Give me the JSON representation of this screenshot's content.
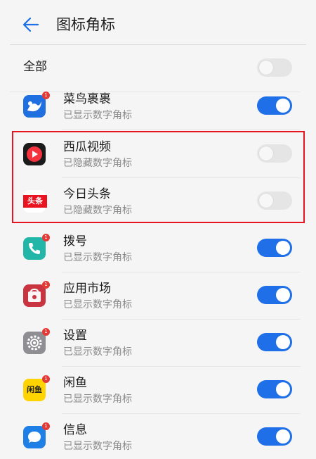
{
  "header": {
    "title": "图标角标"
  },
  "all_row": {
    "label": "全部",
    "toggle_on": false
  },
  "apps": [
    {
      "name": "菜鸟裹裹",
      "status": "已显示数字角标",
      "badge": "1",
      "toggle_on": true,
      "icon": "cainiao-icon"
    },
    {
      "name": "西瓜视频",
      "status": "已隐藏数字角标",
      "badge": "",
      "toggle_on": false,
      "icon": "xigua-icon"
    },
    {
      "name": "今日头条",
      "status": "已隐藏数字角标",
      "badge": "",
      "toggle_on": false,
      "icon": "toutiao-icon",
      "icon_text": "头条"
    },
    {
      "name": "拨号",
      "status": "已显示数字角标",
      "badge": "1",
      "toggle_on": true,
      "icon": "phone-icon"
    },
    {
      "name": "应用市场",
      "status": "已显示数字角标",
      "badge": "1",
      "toggle_on": true,
      "icon": "app-market-icon"
    },
    {
      "name": "设置",
      "status": "已显示数字角标",
      "badge": "1",
      "toggle_on": true,
      "icon": "settings-icon"
    },
    {
      "name": "闲鱼",
      "status": "已显示数字角标",
      "badge": "1",
      "toggle_on": true,
      "icon": "xianyu-icon",
      "icon_text": "闲鱼"
    },
    {
      "name": "信息",
      "status": "已显示数字角标",
      "badge": "1",
      "toggle_on": true,
      "icon": "messages-icon"
    }
  ],
  "colors": {
    "accent": "#1e6fe8",
    "highlight": "#e8141f",
    "badge": "#e53935"
  }
}
